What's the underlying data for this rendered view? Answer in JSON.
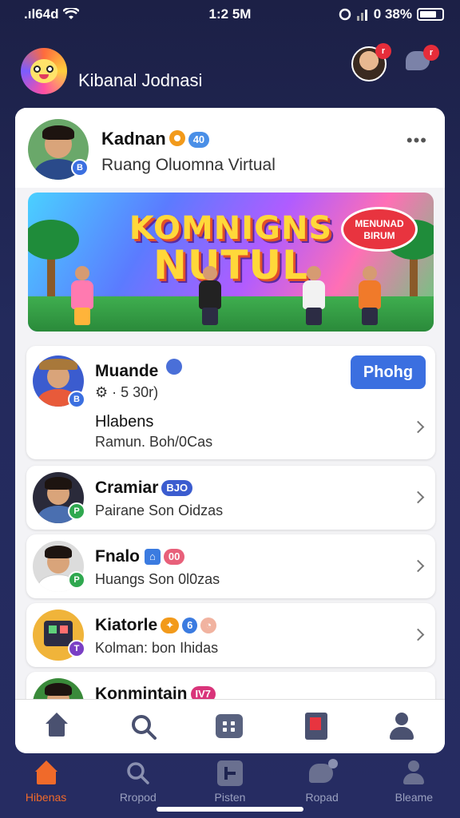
{
  "status_bar": {
    "signal": ".ıl64d",
    "time": "1:2 5M",
    "battery_text": "0 38%"
  },
  "header": {
    "app_title": "Kibanal Jodnasi",
    "badge_avatar": "r",
    "badge_chat": "r"
  },
  "profile": {
    "name": "Kadnan",
    "tag": "40",
    "subtitle": "Ruang Oluomna Virtual",
    "more": "•••",
    "badge": "B"
  },
  "banner": {
    "title_line1": "KOMNIGNS",
    "title_line2": "NUTUL",
    "speech": "MENUNAD BIRUM"
  },
  "featured": {
    "name": "Muande",
    "meta": "⚙ · 5 30r)",
    "title": "Hlabens",
    "subtitle": "Ramun. Boh/0Cas",
    "button": "Phohg",
    "badge": "B"
  },
  "list": [
    {
      "name": "Cramiar",
      "tag": "BJO",
      "tag_color": "#3b5ccf",
      "subtitle": "Pairane Son Oidzas",
      "badge": "P",
      "badge_color": "#2fa84f"
    },
    {
      "name": "Fnalo",
      "tag": "00",
      "tag_color": "#e8607a",
      "subtitle": "Huangs Son 0l0zas",
      "badge": "P",
      "badge_color": "#2fa84f"
    },
    {
      "name": "Kiatorle",
      "tag": "6",
      "tag_color": "#3b7be0",
      "subtitle": "Kolman: bon Ihidas",
      "badge": "T",
      "badge_color": "#7a3fc4"
    },
    {
      "name": "Konmintain",
      "tag": "IV7",
      "tag_color": "#d9347a",
      "subtitle": "",
      "badge": "",
      "badge_color": "#2fa84f"
    }
  ],
  "bottom_nav": [
    {
      "label": "Hibenas",
      "icon": "home-icon",
      "active": true
    },
    {
      "label": "Rropod",
      "icon": "search-icon",
      "active": false
    },
    {
      "label": "Pisten",
      "icon": "grid-icon",
      "active": false
    },
    {
      "label": "Ropad",
      "icon": "chat-icon",
      "active": false
    },
    {
      "label": "Bleame",
      "icon": "profile-icon",
      "active": false
    }
  ],
  "colors": {
    "accent": "#3b6fe0",
    "active_nav": "#f06a2a",
    "background": "#232a5c"
  }
}
